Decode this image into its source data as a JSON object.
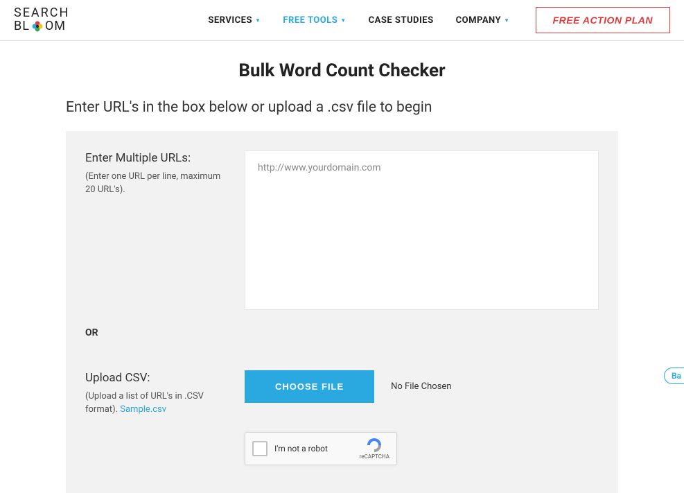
{
  "logo": {
    "top": "SEARCH",
    "bottom_prefix": "BL",
    "bottom_suffix": "OM"
  },
  "nav": {
    "services": "SERVICES",
    "free_tools": "FREE TOOLS",
    "case_studies": "CASE STUDIES",
    "company": "COMPANY"
  },
  "cta": "FREE ACTION PLAN",
  "page": {
    "title": "Bulk Word Count Checker",
    "instruction": "Enter URL's in the box below or upload a .csv file to begin"
  },
  "form": {
    "urls_label": "Enter Multiple URLs:",
    "urls_sub": "(Enter one URL per line, maximum 20 URL's).",
    "urls_placeholder": "http://www.yourdomain.com",
    "or": "OR",
    "csv_label": "Upload CSV:",
    "csv_sub_prefix": "(Upload a list of URL's in .CSV format). ",
    "csv_sample_link": "Sample.csv",
    "choose_file": "CHOOSE FILE",
    "file_status": "No File Chosen"
  },
  "recaptcha": {
    "label": "I'm not a robot",
    "brand": "reCAPTCHA"
  },
  "back": "Ba"
}
